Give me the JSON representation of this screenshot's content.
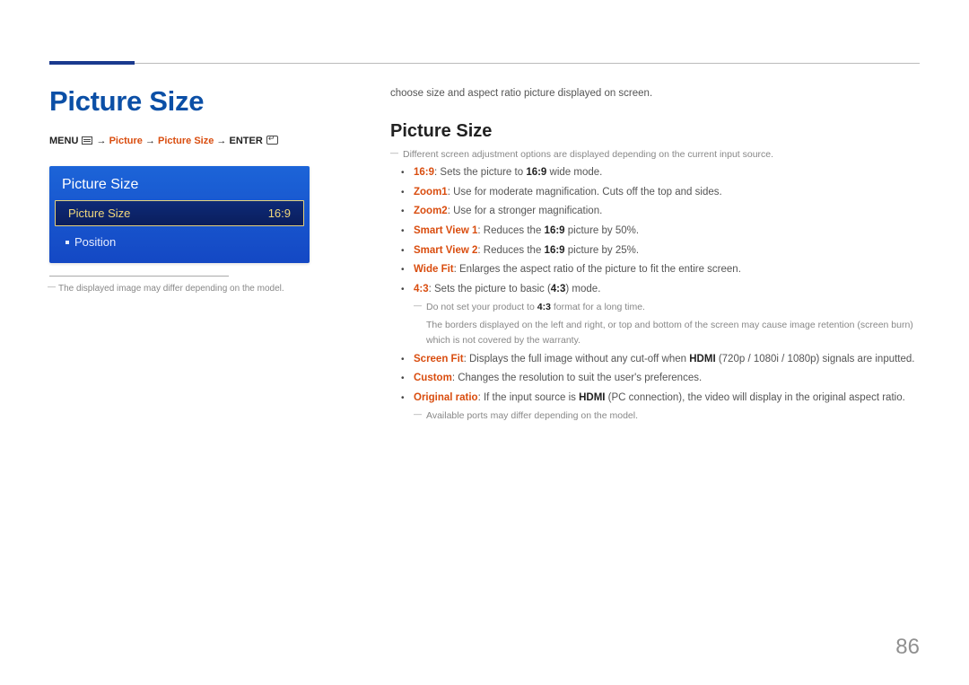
{
  "page_number": "86",
  "left": {
    "title": "Picture Size",
    "breadcrumb": {
      "menu": "MENU",
      "arrow": "→",
      "p1": "Picture",
      "p2": "Picture Size",
      "enter": "ENTER"
    },
    "osd": {
      "title": "Picture Size",
      "selected_label": "Picture Size",
      "selected_value": "16:9",
      "sub_item": "Position"
    },
    "footnote": "The displayed image may differ depending on the model."
  },
  "right": {
    "intro": "choose size and aspect ratio picture displayed on screen.",
    "section_title": "Picture Size",
    "section_note": "Different screen adjustment options are displayed depending on the current input source.",
    "items": [
      {
        "term": "16:9",
        "rest_a": ": Sets the picture to ",
        "mid": "16:9",
        "rest_b": " wide mode."
      },
      {
        "term": "Zoom1",
        "rest": ": Use for moderate magnification. Cuts off the top and sides."
      },
      {
        "term": "Zoom2",
        "rest": ": Use for a stronger magnification."
      },
      {
        "term": "Smart View 1",
        "rest_a": ": Reduces the ",
        "mid": "16:9",
        "rest_b": " picture by 50%."
      },
      {
        "term": "Smart View 2",
        "rest_a": ": Reduces the ",
        "mid": "16:9",
        "rest_b": " picture by 25%."
      },
      {
        "term": "Wide Fit",
        "rest": ": Enlarges the aspect ratio of the picture to fit the entire screen."
      },
      {
        "term": "4:3",
        "rest_a": ": Sets the picture to basic (",
        "mid": "4:3",
        "rest_b": ") mode."
      }
    ],
    "warn43_a": "Do not set your product to ",
    "warn43_b": "4:3",
    "warn43_c": " format for a long time.",
    "warn43_body": "The borders displayed on the left and right, or top and bottom of the screen may cause image retention (screen burn) which is not covered by the warranty.",
    "item_screenfit_term": "Screen Fit",
    "item_screenfit_a": ": Displays the full image without any cut-off when ",
    "item_screenfit_hdmi": "HDMI",
    "item_screenfit_b": " (720p / 1080i / 1080p) signals are inputted.",
    "item_custom_term": "Custom",
    "item_custom_rest": ": Changes the resolution to suit the user's preferences.",
    "item_orig_term": "Original ratio",
    "item_orig_a": ": If the input source is ",
    "item_orig_hdmi": "HDMI",
    "item_orig_b": " (PC connection), the video will display in the original aspect ratio.",
    "ports_note": "Available ports may differ depending on the model."
  }
}
